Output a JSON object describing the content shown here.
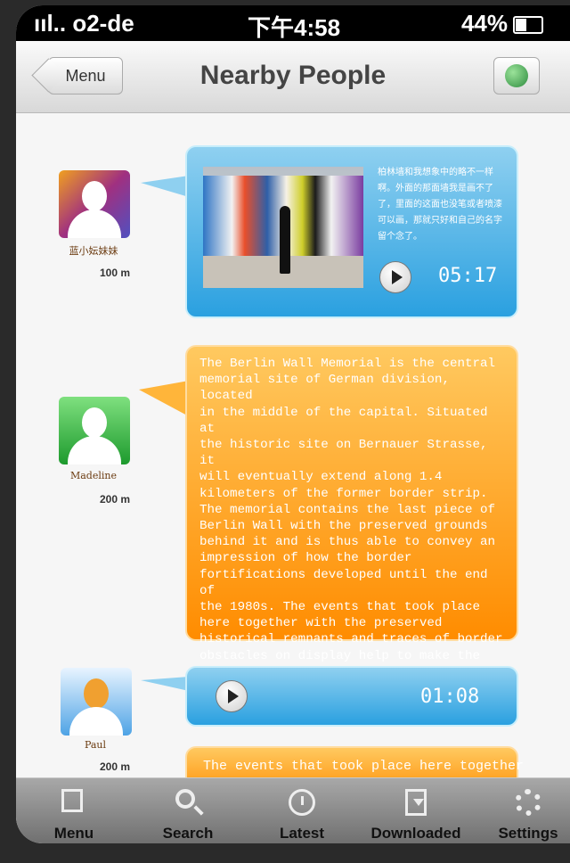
{
  "status_bar": {
    "carrier": "ııl.. o2-de",
    "time": "下午4:58",
    "battery": "44%"
  },
  "nav": {
    "back_label": "Menu",
    "title": "Nearby People",
    "right_icon": "globe-icon"
  },
  "feed": [
    {
      "name": "蓝小妘妹妹",
      "distance": "100 m",
      "avatar_color": "#a03080",
      "bubble": "blue",
      "text": "柏林墙和我想象中的略不一样啊。外面的那面墙我是画不了了，里面的这面也没笔或者喷漆可以画，那就只好和自己的名字留个念了。",
      "duration": "05:17"
    },
    {
      "name": "Madeline",
      "distance": "200 m",
      "avatar_color": "#1d9a2d",
      "bubble": "orange",
      "text": "The Berlin Wall Memorial is the central\nmemorial site of German division, located\nin the middle of the capital. Situated at\nthe historic site on Bernauer Strasse, it\nwill eventually extend along 1.4\nkilometers of the former border strip.\nThe memorial contains the last piece of\nBerlin Wall with the preserved grounds\nbehind it and is thus able to convey an\nimpression of how the border\nfortifications developed until the end of\nthe 1980s. The events that took place\nhere together with the preserved\nhistorical remnants and traces of border\nobstacles on display help to make the\nhistory of Germany’ s division\ncomprehensible to visitors."
    },
    {
      "name": "Paul",
      "distance": "200 m",
      "avatar_color": "#4ea3e5",
      "bubble": "blue",
      "duration": "01:08"
    },
    {
      "bubble": "orange",
      "text": "The events that took place here together"
    }
  ],
  "tabbar": [
    {
      "label": "Menu",
      "icon": "menu-icon"
    },
    {
      "label": "Search",
      "icon": "search-icon"
    },
    {
      "label": "Latest",
      "icon": "clock-icon"
    },
    {
      "label": "Downloaded",
      "icon": "download-icon"
    },
    {
      "label": "Settings",
      "icon": "gear-icon"
    }
  ],
  "colors": {
    "bubble_blue": "#2aa0e0",
    "bubble_orange": "#ff8c00"
  }
}
